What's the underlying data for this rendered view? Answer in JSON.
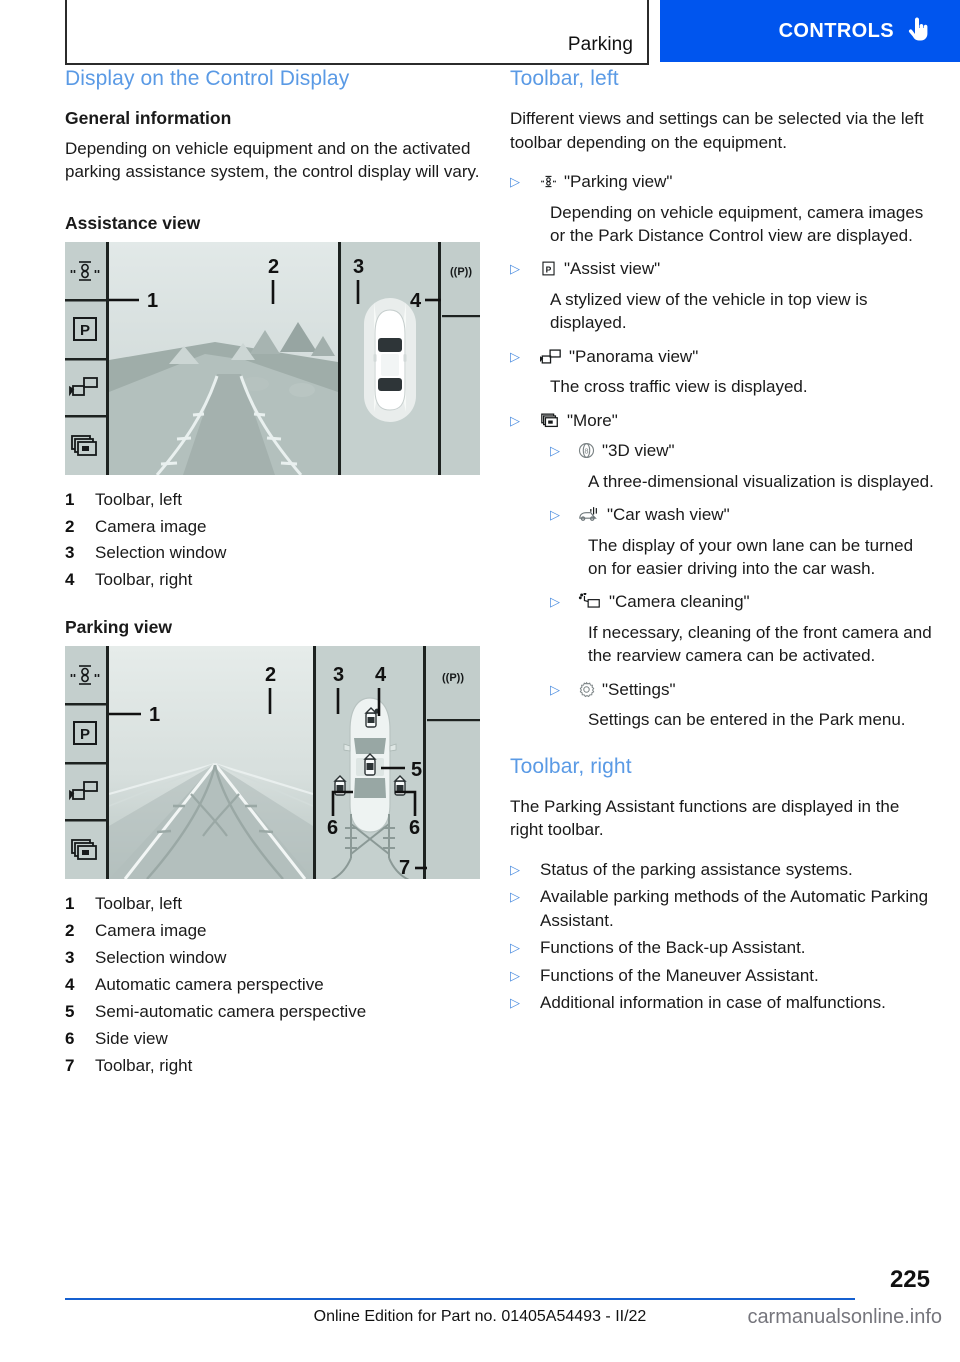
{
  "header": {
    "breadcrumb": "Parking",
    "tab_label": "CONTROLS",
    "tab_icon": "hand-pointer-icon",
    "tab_color": "#0055ee"
  },
  "theme": {
    "heading_blue": "#5a9ae5",
    "bullet_blue": "#4f8fe0",
    "rule_blue": "#1560d0"
  },
  "left_column": {
    "section_title": "Display on the Control Display",
    "general": {
      "heading": "General information",
      "paragraph": "Depending on vehicle equipment and on the activated parking assistance system, the control display will vary."
    },
    "assistance_view": {
      "heading": "Assistance view",
      "figure_name": "assistance-view-illustration",
      "figure_callouts": [
        "1",
        "2",
        "3",
        "4"
      ],
      "figure_icons": [
        "parking-sensor-icon",
        "p-assist-icon",
        "panorama-camera-icon",
        "more-views-icon",
        "pdc-waves-p-icon"
      ],
      "legend": [
        {
          "num": "1",
          "text": "Toolbar, left"
        },
        {
          "num": "2",
          "text": "Camera image"
        },
        {
          "num": "3",
          "text": "Selection window"
        },
        {
          "num": "4",
          "text": "Toolbar, right"
        }
      ]
    },
    "parking_view": {
      "heading": "Parking view",
      "figure_name": "parking-view-illustration",
      "figure_callouts": [
        "1",
        "2",
        "3",
        "4",
        "5",
        "6",
        "6",
        "7"
      ],
      "legend": [
        {
          "num": "1",
          "text": "Toolbar, left"
        },
        {
          "num": "2",
          "text": "Camera image"
        },
        {
          "num": "3",
          "text": "Selection window"
        },
        {
          "num": "4",
          "text": "Automatic camera perspective"
        },
        {
          "num": "5",
          "text": "Semi-automatic camera perspective"
        },
        {
          "num": "6",
          "text": "Side view"
        },
        {
          "num": "7",
          "text": "Toolbar, right"
        }
      ]
    }
  },
  "right_column": {
    "toolbar_left": {
      "section_title": "Toolbar, left",
      "intro": "Different views and settings can be selected via the left toolbar depending on the equipment.",
      "items": [
        {
          "icon": "parking-sensor-icon",
          "label": "\"Parking view\"",
          "desc": "Depending on vehicle equipment, camera images or the Park Distance Control view are displayed."
        },
        {
          "icon": "p-assist-icon",
          "label": "\"Assist view\"",
          "desc": "A stylized view of the vehicle in top view is displayed."
        },
        {
          "icon": "panorama-camera-icon",
          "label": "\"Panorama view\"",
          "desc": "The cross traffic view is displayed."
        },
        {
          "icon": "more-views-icon",
          "label": "\"More\"",
          "desc": "",
          "children": [
            {
              "icon": "three-d-view-icon",
              "label": "\"3D view\"",
              "desc": "A three-dimensional visualization is displayed."
            },
            {
              "icon": "car-wash-view-icon",
              "label": "\"Car wash view\"",
              "desc": "The display of your own lane can be turned on for easier driving into the car wash."
            },
            {
              "icon": "camera-cleaning-icon",
              "label": "\"Camera cleaning\"",
              "desc": "If necessary, cleaning of the front camera and the rearview camera can be activated."
            },
            {
              "icon": "gear-icon",
              "label": "\"Settings\"",
              "desc": "Settings can be entered in the Park menu."
            }
          ]
        }
      ]
    },
    "toolbar_right": {
      "section_title": "Toolbar, right",
      "intro": "The Parking Assistant functions are displayed in the right toolbar.",
      "bullets": [
        "Status of the parking assistance systems.",
        "Available parking methods of the Automatic Parking Assistant.",
        "Functions of the Back-up Assistant.",
        "Functions of the Maneuver Assistant.",
        "Additional information in case of malfunctions."
      ]
    }
  },
  "footer": {
    "page_number": "225",
    "edition_text": "Online Edition for Part no. 01405A54493 - II/22",
    "watermark": "carmanualsonline.info"
  }
}
